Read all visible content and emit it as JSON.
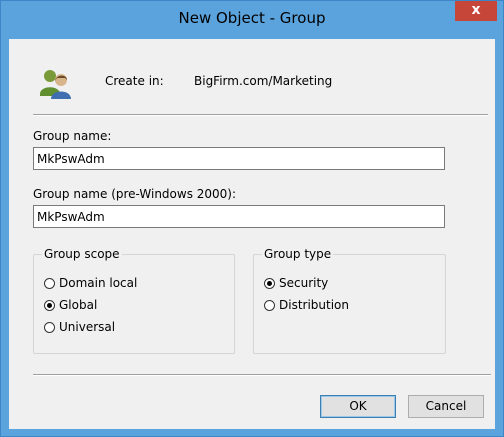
{
  "window": {
    "title": "New Object - Group",
    "close_glyph": "x"
  },
  "header": {
    "icon": "users-group-icon",
    "create_in_label": "Create in:",
    "create_in_path": "BigFirm.com/Marketing"
  },
  "fields": {
    "group_name_label": "Group name:",
    "group_name_value": "MkPswAdm",
    "pre2000_label": "Group name (pre-Windows 2000):",
    "pre2000_value": "MkPswAdm"
  },
  "group_scope": {
    "title": "Group scope",
    "options": [
      {
        "label": "Domain local",
        "selected": false
      },
      {
        "label": "Global",
        "selected": true
      },
      {
        "label": "Universal",
        "selected": false
      }
    ]
  },
  "group_type": {
    "title": "Group type",
    "options": [
      {
        "label": "Security",
        "selected": true
      },
      {
        "label": "Distribution",
        "selected": false
      }
    ]
  },
  "buttons": {
    "ok_label": "OK",
    "cancel_label": "Cancel"
  },
  "colors": {
    "titlebar": "#5ba3dd",
    "close_button": "#c7463a",
    "dialog_background": "#f0f0f0"
  }
}
